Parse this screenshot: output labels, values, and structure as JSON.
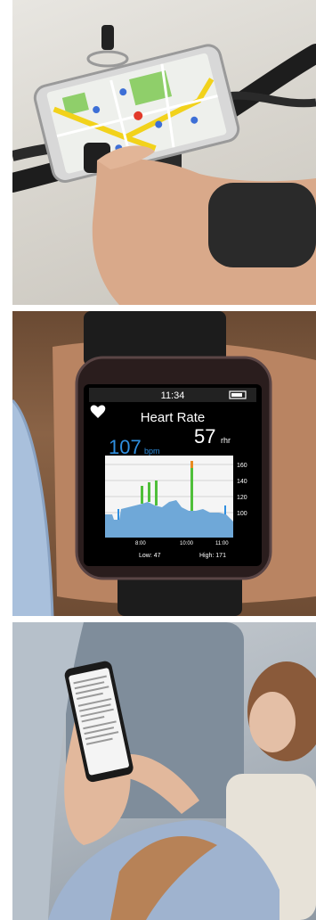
{
  "watch": {
    "time": "11:34",
    "title": "Heart Rate",
    "bpm_value": "107",
    "bpm_unit": "bpm",
    "rhr_value": "57",
    "rhr_unit": "rhr",
    "y_ticks": [
      "160",
      "140",
      "120",
      "100"
    ],
    "x_ticks": [
      "8:00",
      "10:00",
      "11:00"
    ],
    "low_label": "Low: 47",
    "high_label": "High: 171"
  },
  "colors": {
    "bpm_blue": "#2f8fe0",
    "graph_fill": "#6fa8d8",
    "spike_green": "#4fbf3a",
    "spike_orange": "#e98a1f"
  }
}
